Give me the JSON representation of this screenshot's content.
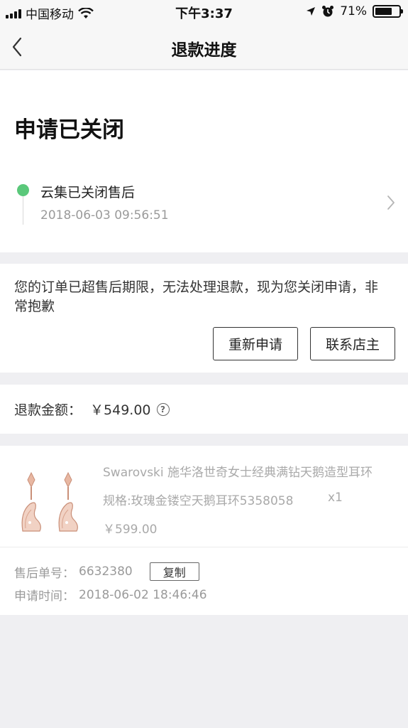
{
  "status_bar": {
    "carrier": "中国移动",
    "time": "下午3:37",
    "battery": "71%",
    "battery_level": 0.71
  },
  "nav": {
    "title": "退款进度"
  },
  "refund_status": {
    "headline": "申请已关闭",
    "event_title": "云集已关闭售后",
    "event_time": "2018-06-03 09:56:51",
    "dot_color": "#5ac87a"
  },
  "notice": {
    "text": "您的订单已超售后期限，无法处理退款，现为您关闭申请，非常抱歉",
    "reapply_label": "重新申请",
    "contact_label": "联系店主"
  },
  "amount": {
    "label": "退款金额：",
    "value": "￥549.00",
    "help_icon": "?"
  },
  "product": {
    "name": "Swarovski 施华洛世奇女士经典满钻天鹅造型耳环",
    "spec": "规格:玫瑰金镂空天鹅耳环5358058",
    "qty": "x1",
    "price": "￥599.00"
  },
  "order": {
    "number_label": "售后单号：",
    "number": "6632380",
    "copy_label": "复制",
    "time_label": "申请时间：",
    "time": "2018-06-02 18:46:46"
  },
  "colors": {
    "accent_green": "#5ac87a",
    "background": "#efeff2",
    "muted_text": "#9a9a9a"
  }
}
